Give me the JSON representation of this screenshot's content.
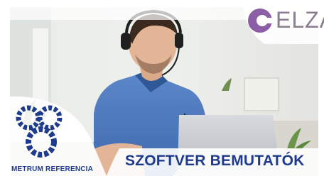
{
  "brand": {
    "name": "ELZA",
    "accent": "#8b5ea6"
  },
  "badge": {
    "label": "METRUM REFERENCIA",
    "color": "#1f3c8c"
  },
  "cta": {
    "title": "SZOFTVER BEMUTATÓK",
    "color": "#1f3c8c"
  },
  "icons": [
    "elza-logo-icon",
    "metrum-gears-icon"
  ]
}
